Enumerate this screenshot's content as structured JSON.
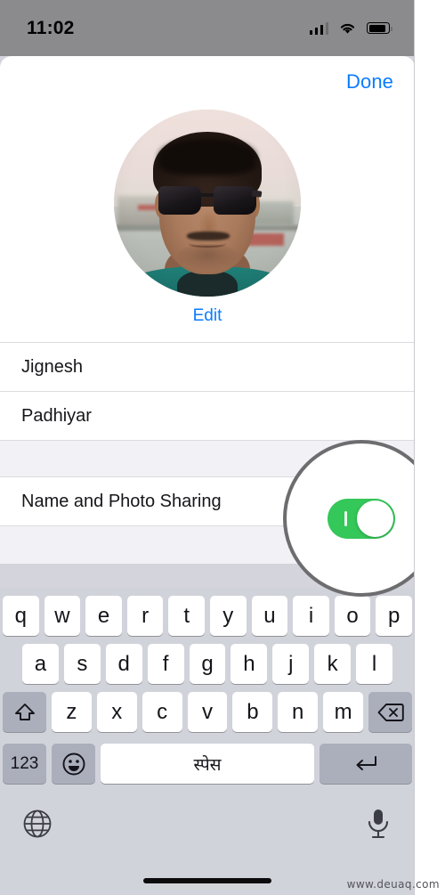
{
  "status_bar": {
    "time": "11:02",
    "icons": [
      "cellular-signal-icon",
      "wifi-icon",
      "battery-icon"
    ]
  },
  "sheet": {
    "done_label": "Done",
    "edit_label": "Edit",
    "avatar_name": "profile-photo"
  },
  "list": {
    "first_name": "Jignesh",
    "last_name": "Padhiyar",
    "sharing_label": "Name and Photo Sharing",
    "sharing_enabled": true,
    "toggle_on_color": "#34c759"
  },
  "highlight": {
    "ring_color": "#6d6d70",
    "target": "name-and-photo-sharing-toggle"
  },
  "keyboard": {
    "row1": [
      "q",
      "w",
      "e",
      "r",
      "t",
      "y",
      "u",
      "i",
      "o",
      "p"
    ],
    "row2": [
      "a",
      "s",
      "d",
      "f",
      "g",
      "h",
      "j",
      "k",
      "l"
    ],
    "row3": [
      "z",
      "x",
      "c",
      "v",
      "b",
      "n",
      "m"
    ],
    "shift_icon": "shift-arrow-icon",
    "delete_icon": "backspace-delete-icon",
    "numeric_label": "123",
    "emoji_icon": "smiley-emoji-icon",
    "space_label": "स्पेस",
    "return_icon": "return-enter-icon",
    "globe_icon": "globe-language-icon",
    "mic_icon": "microphone-dictation-icon"
  },
  "accents": {
    "ios_blue": "#0a7cff",
    "status_bar_bg": "#8b8b8d",
    "keyboard_bg": "#d1d3db",
    "group_gap_bg": "#f1f1f6"
  },
  "watermark": "www.deuaq.com"
}
